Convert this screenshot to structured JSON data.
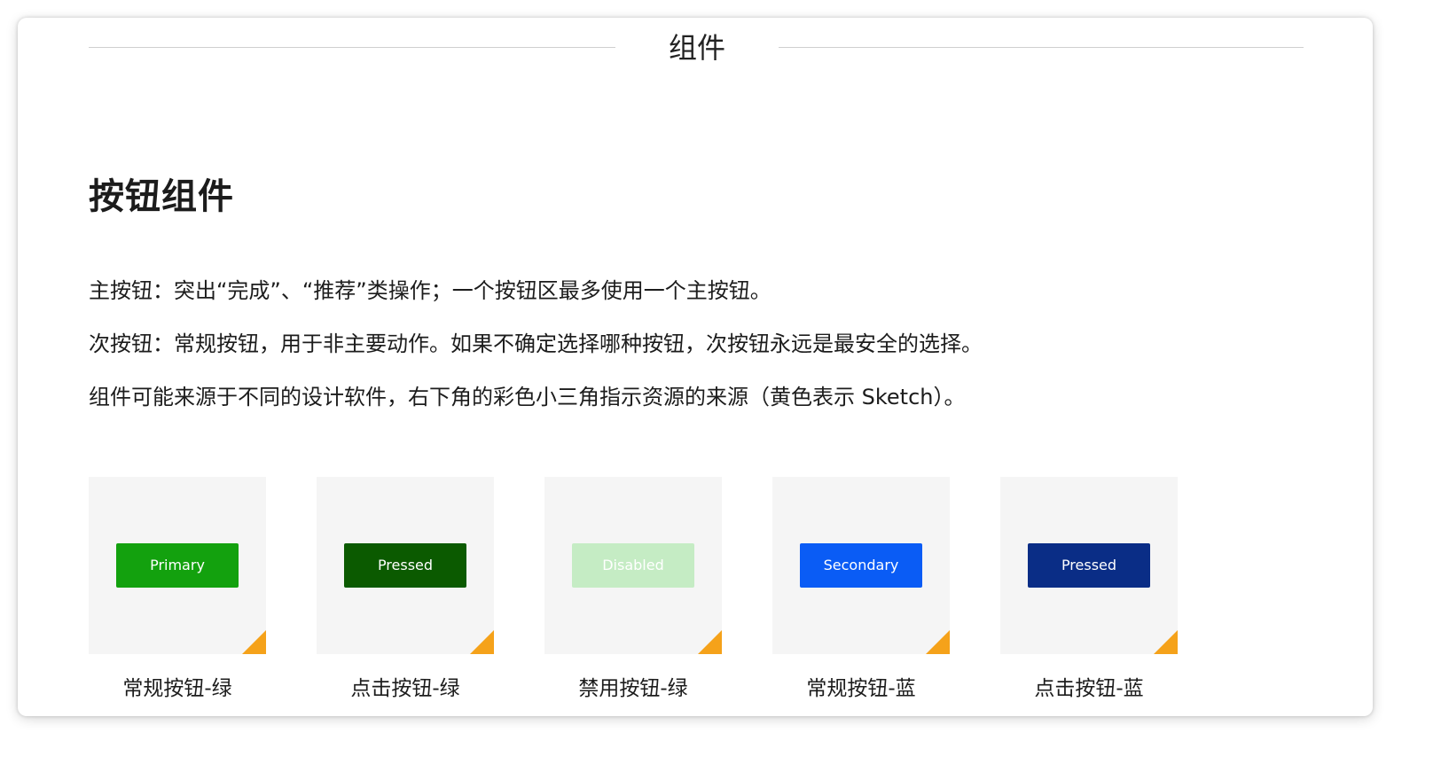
{
  "header": {
    "title": "组件"
  },
  "section": {
    "title": "按钮组件",
    "descriptions": [
      "主按钮：突出“完成”、“推荐”类操作；一个按钮区最多使用一个主按钮。",
      "次按钮：常规按钮，用于非主要动作。如果不确定选择哪种按钮，次按钮永远是最安全的选择。",
      "组件可能来源于不同的设计软件，右下角的彩色小三角指示资源的来源（黄色表示 Sketch）。"
    ]
  },
  "cards": [
    {
      "button_label": "Primary",
      "button_color": "#13a10e",
      "text_color": "#ffffff",
      "caption": "常规按钮-绿",
      "corner_icon": "sketch-source-triangle-icon"
    },
    {
      "button_label": "Pressed",
      "button_color": "#0b5a00",
      "text_color": "#ffffff",
      "caption": "点击按钮-绿",
      "corner_icon": "sketch-source-triangle-icon"
    },
    {
      "button_label": "Disabled",
      "button_color": "#c5ecc4",
      "text_color": "#ffffff",
      "caption": "禁用按钮-绿",
      "corner_icon": "sketch-source-triangle-icon"
    },
    {
      "button_label": "Secondary",
      "button_color": "#0a5cf5",
      "text_color": "#ffffff",
      "caption": "常规按钮-蓝",
      "corner_icon": "sketch-source-triangle-icon"
    },
    {
      "button_label": "Pressed",
      "button_color": "#0a2d86",
      "text_color": "#ffffff",
      "caption": "点击按钮-蓝",
      "corner_icon": "sketch-source-triangle-icon"
    }
  ],
  "colors": {
    "tile_background": "#f5f5f5",
    "sketch_indicator": "#f5a21a",
    "header_rule": "#cfcfcf"
  }
}
